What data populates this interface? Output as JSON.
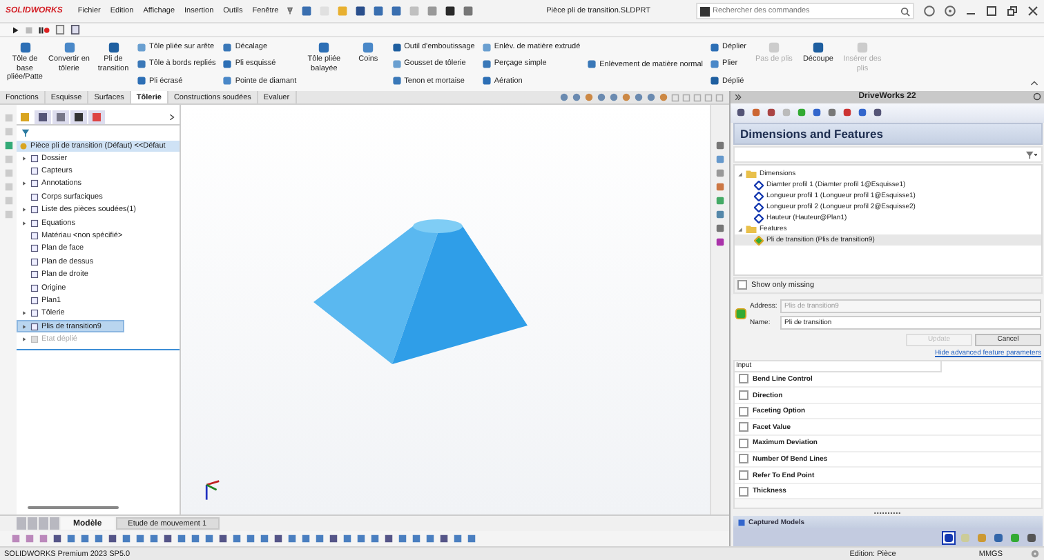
{
  "title_bar": {
    "logo": "SOLIDWORKS",
    "menu": [
      "Fichier",
      "Edition",
      "Affichage",
      "Insertion",
      "Outils",
      "Fenêtre"
    ],
    "document": "Pièce pli de transition.SLDPRT",
    "search": {
      "placeholder": "Rechercher des commandes"
    }
  },
  "ribbon": [
    {
      "kind": "large",
      "items": [
        {
          "label": "Tôle de base pliée/Patte",
          "disabled": false
        }
      ]
    },
    {
      "kind": "large",
      "items": [
        {
          "label": "Convertir en tôlerie",
          "disabled": false
        }
      ]
    },
    {
      "kind": "large",
      "items": [
        {
          "label": "Pli de transition",
          "disabled": false
        }
      ]
    },
    {
      "kind": "stack",
      "items": [
        {
          "label": "Tôle pliée sur arête",
          "disabled": false
        },
        {
          "label": "Tôle à bords repliés",
          "disabled": false
        },
        {
          "label": "Pli écrasé",
          "disabled": false
        }
      ]
    },
    {
      "kind": "stack",
      "items": [
        {
          "label": "Décalage",
          "disabled": false
        },
        {
          "label": "Pli esquissé",
          "disabled": false
        },
        {
          "label": "Pointe de diamant",
          "disabled": false
        }
      ]
    },
    {
      "kind": "large",
      "items": [
        {
          "label": "Tôle pliée balayée",
          "disabled": false
        }
      ]
    },
    {
      "kind": "large",
      "items": [
        {
          "label": "Coins",
          "disabled": false
        }
      ]
    },
    {
      "kind": "stack",
      "items": [
        {
          "label": "Outil d'emboutissage",
          "disabled": false
        },
        {
          "label": "Gousset de tôlerie",
          "disabled": false
        },
        {
          "label": "Tenon et mortaise",
          "disabled": false
        }
      ]
    },
    {
      "kind": "stack",
      "items": [
        {
          "label": "Enlèv. de matière extrudé",
          "disabled": false
        },
        {
          "label": "Perçage simple",
          "disabled": false
        },
        {
          "label": "Aération",
          "disabled": false
        }
      ]
    },
    {
      "kind": "stack",
      "items": [
        {
          "label": "Enlèvement de matière normal",
          "disabled": false
        }
      ]
    },
    {
      "kind": "stack",
      "items": [
        {
          "label": "Déplier",
          "disabled": false
        },
        {
          "label": "Plier",
          "disabled": false
        },
        {
          "label": "Déplié",
          "disabled": false
        }
      ]
    },
    {
      "kind": "large",
      "items": [
        {
          "label": "Pas de plis",
          "disabled": true
        }
      ]
    },
    {
      "kind": "large",
      "items": [
        {
          "label": "Découpe",
          "disabled": false
        }
      ]
    },
    {
      "kind": "large",
      "items": [
        {
          "label": "Insérer des plis",
          "disabled": true
        }
      ]
    }
  ],
  "tabs": [
    {
      "label": "Fonctions",
      "selected": false
    },
    {
      "label": "Esquisse",
      "selected": false
    },
    {
      "label": "Surfaces",
      "selected": false
    },
    {
      "label": "Tôlerie",
      "selected": true
    },
    {
      "label": "Constructions soudées",
      "selected": false
    },
    {
      "label": "Evaluer",
      "selected": false
    }
  ],
  "feature_tree": {
    "root": "Pièce pli de transition (Défaut) <<Défaut",
    "items": [
      {
        "label": "Dossier",
        "expandable": true,
        "selected": false,
        "disabled": false
      },
      {
        "label": "Capteurs",
        "expandable": false,
        "selected": false,
        "disabled": false
      },
      {
        "label": "Annotations",
        "expandable": true,
        "selected": false,
        "disabled": false
      },
      {
        "label": "Corps surfaciques",
        "expandable": false,
        "selected": false,
        "disabled": false
      },
      {
        "label": "Liste des pièces soudées(1)",
        "expandable": true,
        "selected": false,
        "disabled": false
      },
      {
        "label": "Equations",
        "expandable": true,
        "selected": false,
        "disabled": false
      },
      {
        "label": "Matériau <non spécifié>",
        "expandable": false,
        "selected": false,
        "disabled": false
      },
      {
        "label": "Plan de face",
        "expandable": false,
        "selected": false,
        "disabled": false
      },
      {
        "label": "Plan de dessus",
        "expandable": false,
        "selected": false,
        "disabled": false
      },
      {
        "label": "Plan de droite",
        "expandable": false,
        "selected": false,
        "disabled": false
      },
      {
        "label": "Origine",
        "expandable": false,
        "selected": false,
        "disabled": false
      },
      {
        "label": "Plan1",
        "expandable": false,
        "selected": false,
        "disabled": false
      },
      {
        "label": "Tôlerie",
        "expandable": true,
        "selected": false,
        "disabled": false
      },
      {
        "label": "Plis de transition9",
        "expandable": true,
        "selected": true,
        "disabled": false
      },
      {
        "label": "Etat déplié",
        "expandable": true,
        "selected": false,
        "disabled": true
      }
    ]
  },
  "model_tabs": [
    {
      "label": "Modèle",
      "selected": true
    },
    {
      "label": "Etude de mouvement 1",
      "selected": false
    }
  ],
  "driveworks": {
    "title": "DriveWorks 22",
    "heading": "Dimensions and Features",
    "tree": [
      {
        "label": "Dimensions",
        "expanded": true,
        "selected": false,
        "children": [
          {
            "label": "Diamter profil 1 (Diamter profil 1@Esquisse1)",
            "selected": false
          },
          {
            "label": "Longueur profil 1 (Longueur profil 1@Esquisse1)",
            "selected": false
          },
          {
            "label": "Longueur profil 2 (Longueur profil 2@Esquisse2)",
            "selected": false
          },
          {
            "label": "Hauteur (Hauteur@Plan1)",
            "selected": false
          }
        ]
      },
      {
        "label": "Features",
        "expanded": true,
        "selected": false,
        "children": [
          {
            "label": "Pli de transition (Plis de transition9)",
            "selected": true
          }
        ]
      }
    ],
    "show_only_missing": {
      "label": "Show only missing",
      "checked": false
    },
    "address": {
      "label": "Address:",
      "value": "Plis de transition9"
    },
    "name": {
      "label": "Name:",
      "value": "Pli de transition"
    },
    "buttons": [
      {
        "label": "Update",
        "disabled": true
      },
      {
        "label": "Cancel",
        "disabled": false
      }
    ],
    "link": "Hide advanced feature parameters",
    "input_header": "Input",
    "parameters": [
      {
        "label": "Bend Line Control",
        "checked": false
      },
      {
        "label": "Direction",
        "checked": false
      },
      {
        "label": "Faceting Option",
        "checked": false
      },
      {
        "label": "Facet Value",
        "checked": false
      },
      {
        "label": "Maximum Deviation",
        "checked": false
      },
      {
        "label": "Number Of Bend Lines",
        "checked": false
      },
      {
        "label": "Refer To End Point",
        "checked": false
      },
      {
        "label": "Thickness",
        "checked": false
      }
    ],
    "captured_models": "Captured Models"
  },
  "status_bar": {
    "product": "SOLIDWORKS Premium 2023 SP5.0",
    "mode": "Edition: Pièce",
    "units": "MMGS"
  }
}
